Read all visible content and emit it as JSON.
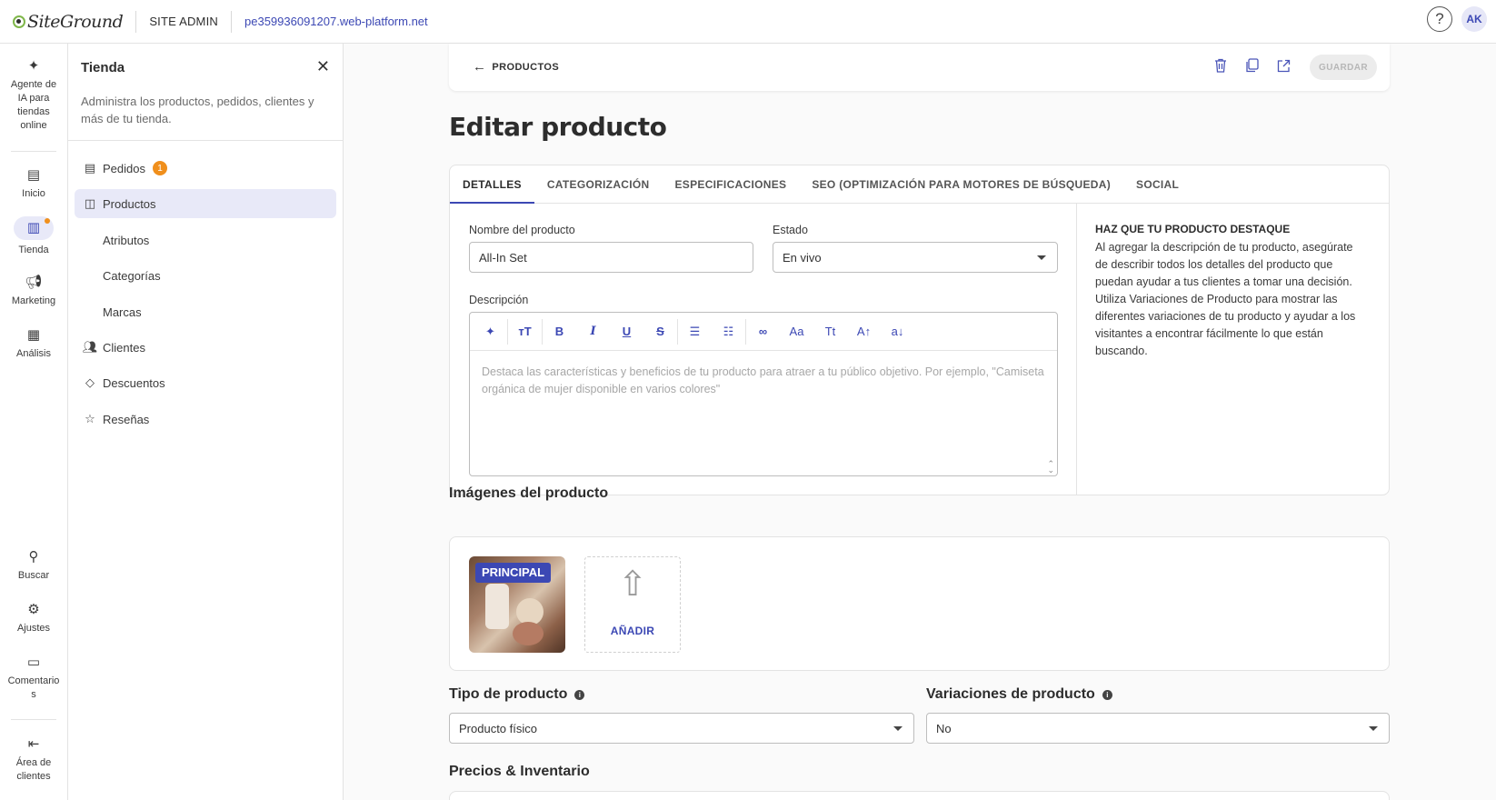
{
  "topbar": {
    "logo_text": "SiteGround",
    "site_admin": "SITE ADMIN",
    "domain": "pe359936091207.web-platform.net",
    "help": "?",
    "avatar": "AK"
  },
  "rail": {
    "items": [
      {
        "label": "Agente de IA para tiendas online",
        "icon": "sparkle-icon"
      },
      {
        "label": "Inicio",
        "icon": "home-icon"
      },
      {
        "label": "Tienda",
        "icon": "store-icon"
      },
      {
        "label": "Marketing",
        "icon": "megaphone-icon"
      },
      {
        "label": "Análisis",
        "icon": "chart-icon"
      },
      {
        "label": "Buscar",
        "icon": "search-icon"
      },
      {
        "label": "Ajustes",
        "icon": "gear-icon"
      },
      {
        "label": "Comentarios",
        "icon": "comment-icon"
      },
      {
        "label": "Área de clientes",
        "icon": "exit-icon"
      }
    ]
  },
  "subnav": {
    "title": "Tienda",
    "description": "Administra los productos, pedidos, clientes y más de tu tienda.",
    "items": [
      {
        "label": "Pedidos",
        "badge": "1",
        "icon": "receipt-icon"
      },
      {
        "label": "Productos",
        "icon": "bag-icon"
      },
      {
        "label": "Atributos"
      },
      {
        "label": "Categorías"
      },
      {
        "label": "Marcas"
      },
      {
        "label": "Clientes",
        "icon": "users-icon"
      },
      {
        "label": "Descuentos",
        "icon": "tag-icon"
      },
      {
        "label": "Reseñas",
        "icon": "star-icon"
      }
    ]
  },
  "toolbar": {
    "back": "PRODUCTOS",
    "save": "GUARDAR"
  },
  "page": {
    "title": "Editar producto"
  },
  "tabs": [
    {
      "label": "DETALLES"
    },
    {
      "label": "CATEGORIZACIÓN"
    },
    {
      "label": "ESPECIFICACIONES"
    },
    {
      "label": "SEO (OPTIMIZACIÓN PARA MOTORES DE BÚSQUEDA)"
    },
    {
      "label": "SOCIAL"
    }
  ],
  "form": {
    "name_label": "Nombre del producto",
    "name_value": "All-In Set",
    "status_label": "Estado",
    "status_value": "En vivo",
    "desc_label": "Descripción",
    "desc_placeholder": "Destaca las características y beneficios de tu producto para atraer a tu público objetivo. Por ejemplo, \"Camiseta orgánica de mujer disponible en varios colores\""
  },
  "tip": {
    "title": "HAZ QUE TU PRODUCTO DESTAQUE",
    "text": "Al agregar la descripción de tu producto, asegúrate de describir todos los detalles del producto que puedan ayudar a tus clientes a tomar una decisión. Utiliza Variaciones de Producto para mostrar las diferentes variaciones de tu producto y ayudar a los visitantes a encontrar fácilmente lo que están buscando."
  },
  "images": {
    "title": "Imágenes del producto",
    "principal": "PRINCIPAL",
    "add": "AÑADIR"
  },
  "product_type": {
    "title": "Tipo de producto",
    "value": "Producto físico"
  },
  "variations": {
    "title": "Variaciones de producto",
    "value": "No"
  },
  "pricing": {
    "title": "Precios & Inventario"
  },
  "colors": {
    "accent": "#3c48b4",
    "badge": "#f08f1c"
  }
}
